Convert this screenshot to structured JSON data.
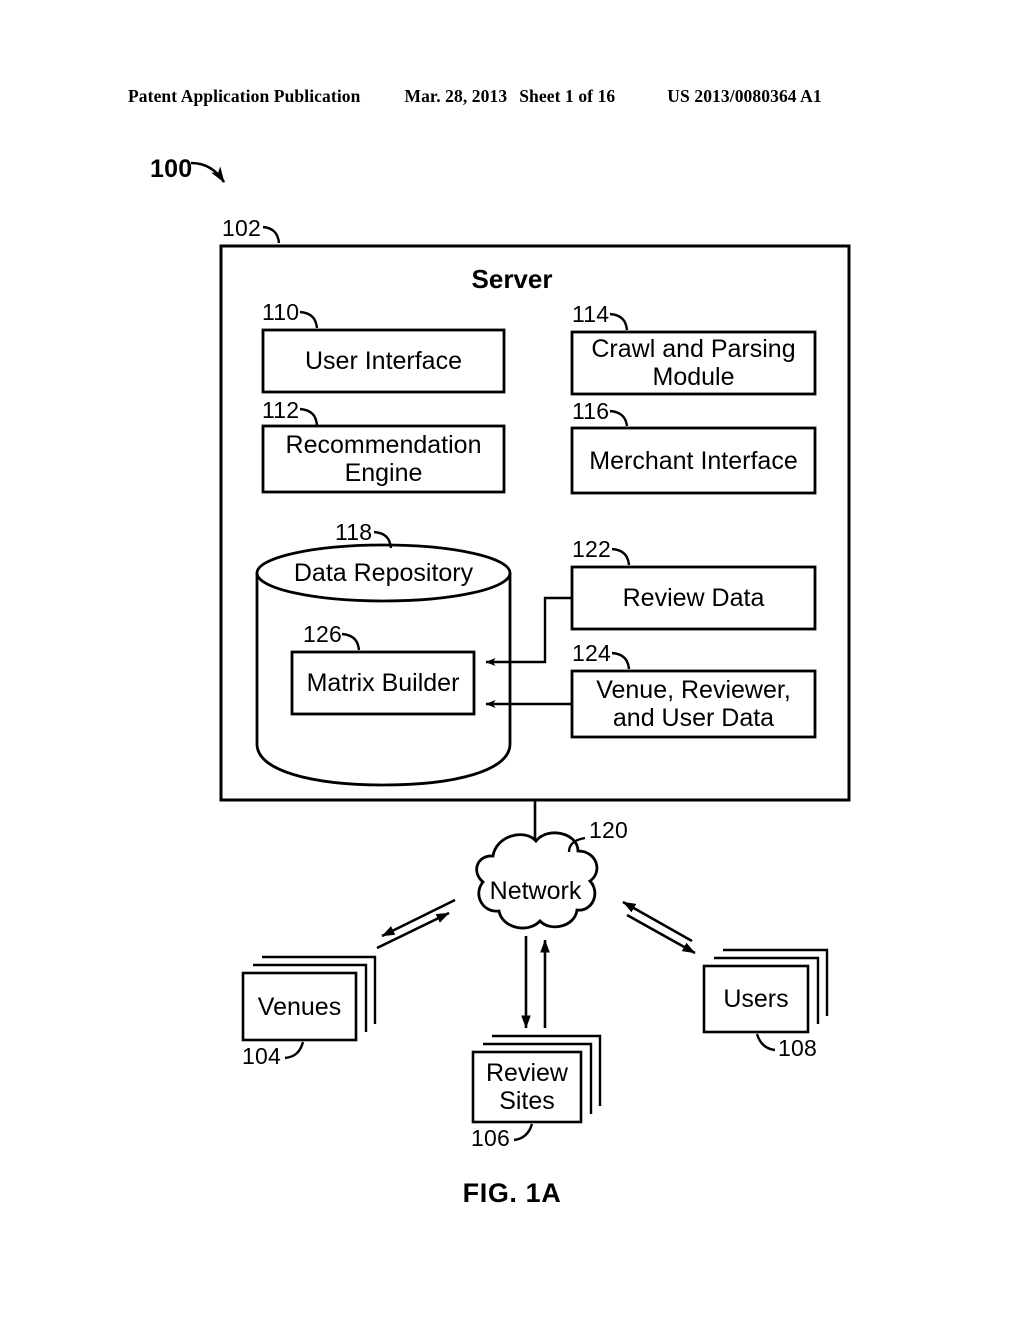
{
  "header": {
    "publication": "Patent Application Publication",
    "date": "Mar. 28, 2013",
    "sheet": "Sheet 1 of 16",
    "patent_number": "US 2013/0080364 A1"
  },
  "figure": {
    "caption": "FIG. 1A",
    "system_ref": "100"
  },
  "server": {
    "ref": "102",
    "title": "Server",
    "modules": [
      {
        "ref": "110",
        "label": "User Interface"
      },
      {
        "ref": "114",
        "label": "Crawl and Parsing Module"
      },
      {
        "ref": "112",
        "label": "Recommendation Engine"
      },
      {
        "ref": "116",
        "label": "Merchant Interface"
      }
    ],
    "repository": {
      "ref": "118",
      "label": "Data Repository",
      "inner": {
        "ref": "126",
        "label": "Matrix Builder"
      }
    },
    "data_sources": [
      {
        "ref": "122",
        "label": "Review Data"
      },
      {
        "ref": "124",
        "label": "Venue, Reviewer, and User Data"
      }
    ]
  },
  "network": {
    "ref": "120",
    "label": "Network"
  },
  "endpoints": [
    {
      "ref": "104",
      "label": "Venues"
    },
    {
      "ref": "106",
      "label": "Review Sites"
    },
    {
      "ref": "108",
      "label": "Users"
    }
  ],
  "colors": {
    "ink": "#000000",
    "paper": "#ffffff"
  }
}
